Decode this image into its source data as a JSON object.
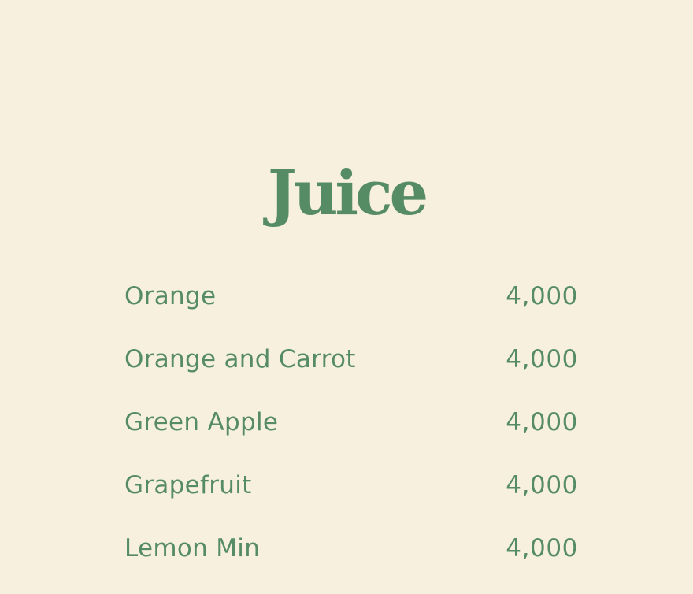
{
  "menu": {
    "title": "Juice",
    "items": [
      {
        "name": "Orange",
        "price": "4,000"
      },
      {
        "name": "Orange and Carrot",
        "price": "4,000"
      },
      {
        "name": "Green Apple",
        "price": "4,000"
      },
      {
        "name": "Grapefruit",
        "price": "4,000"
      },
      {
        "name": "Lemon Min",
        "price": "4,000"
      }
    ]
  },
  "colors": {
    "background": "#f7f0de",
    "accent": "#568c64"
  }
}
